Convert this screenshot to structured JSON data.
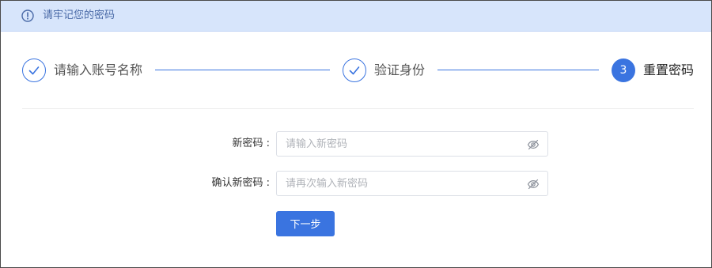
{
  "notice": {
    "icon": "exclamation-circle-icon",
    "text": "请牢记您的密码"
  },
  "steps": [
    {
      "status": "done",
      "icon": "check-icon",
      "label": "请输入账号名称"
    },
    {
      "status": "done",
      "icon": "check-icon",
      "label": "验证身份"
    },
    {
      "status": "active",
      "number": "3",
      "label": "重置密码"
    }
  ],
  "form": {
    "new_password": {
      "label": "新密码 :",
      "placeholder": "请输入新密码",
      "value": "",
      "toggle_icon": "eye-off-icon"
    },
    "confirm_password": {
      "label": "确认新密码 :",
      "placeholder": "请再次输入新密码",
      "value": "",
      "toggle_icon": "eye-off-icon"
    },
    "next_label": "下一步"
  },
  "colors": {
    "accent": "#3a74e0",
    "notice_bg": "#d7e5fb",
    "notice_text": "#4a6aa7"
  }
}
